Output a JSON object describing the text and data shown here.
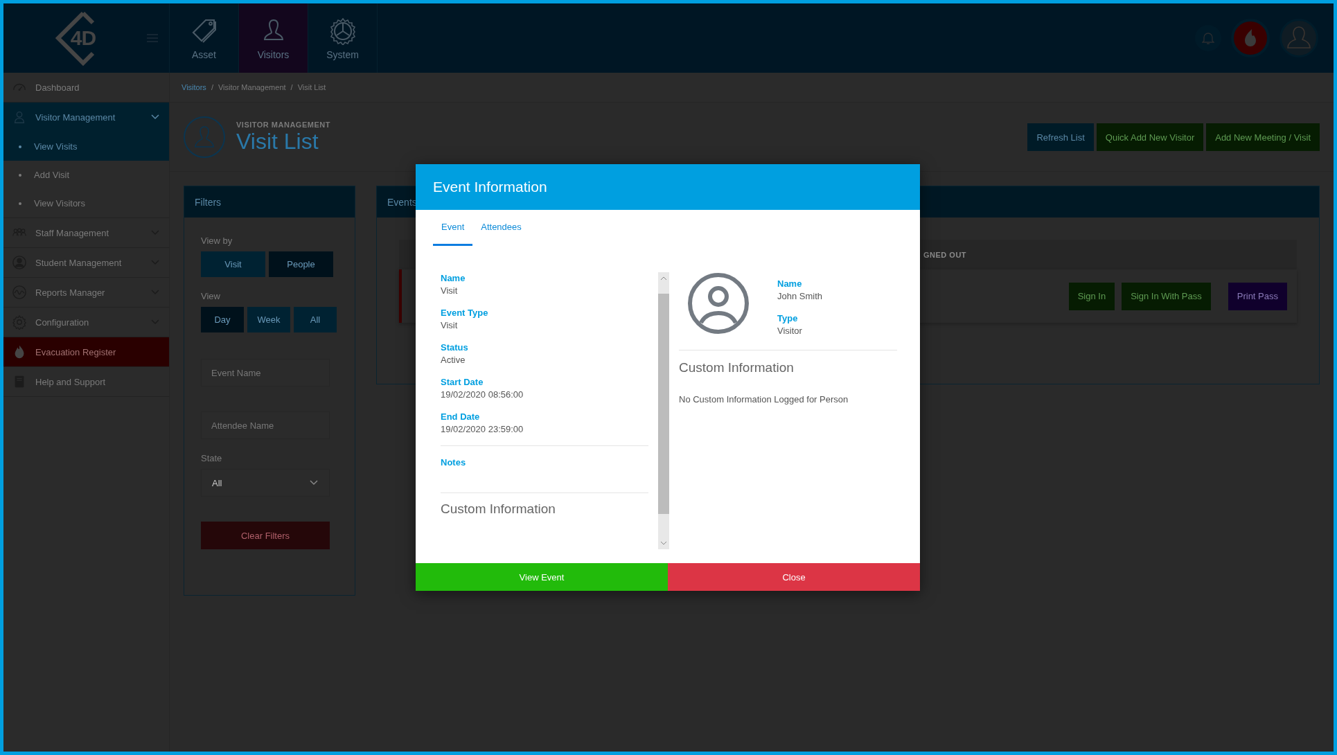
{
  "header": {
    "logo_text": "4D",
    "nav_tabs": [
      {
        "label": "Asset",
        "selected": false
      },
      {
        "label": "Visitors",
        "selected": true
      },
      {
        "label": "System",
        "selected": false
      }
    ]
  },
  "sidebar": {
    "items": [
      {
        "label": "Dashboard",
        "kind": "link",
        "selected": false
      },
      {
        "label": "Visitor Management",
        "kind": "group",
        "selected": true,
        "children": [
          {
            "label": "View Visits",
            "selected": true
          },
          {
            "label": "Add Visit",
            "selected": false
          },
          {
            "label": "View Visitors",
            "selected": false
          }
        ]
      },
      {
        "label": "Staff Management",
        "kind": "group",
        "selected": false
      },
      {
        "label": "Student Management",
        "kind": "group",
        "selected": false
      },
      {
        "label": "Reports Manager",
        "kind": "group",
        "selected": false
      },
      {
        "label": "Configuration",
        "kind": "group",
        "selected": false
      },
      {
        "label": "Evacuation Register",
        "kind": "alert",
        "selected": false
      },
      {
        "label": "Help and Support",
        "kind": "link",
        "selected": false
      }
    ]
  },
  "breadcrumb": {
    "items": [
      "Visitors",
      "Visitor Management",
      "Visit List"
    ],
    "separators": [
      "/",
      "/"
    ]
  },
  "page_header": {
    "overline": "VISITOR MANAGEMENT",
    "title": "Visit List"
  },
  "actions": [
    {
      "label": "Refresh List",
      "kind": "primary"
    },
    {
      "label": "Quick Add New Visitor",
      "kind": "success"
    },
    {
      "label": "Add New Meeting / Visit",
      "kind": "success"
    }
  ],
  "filters": {
    "title": "Filters",
    "view_by_label": "View by",
    "view_by": [
      {
        "label": "Visit",
        "selected": false
      },
      {
        "label": "People",
        "selected": true
      }
    ],
    "view_label": "View",
    "view": [
      {
        "label": "Day",
        "selected": true
      },
      {
        "label": "Week",
        "selected": false
      },
      {
        "label": "All",
        "selected": false
      }
    ],
    "event_name": {
      "placeholder": "Event Name"
    },
    "attendee_name": {
      "placeholder": "Attendee Name"
    },
    "state_label": "State",
    "state": {
      "value": "All"
    },
    "clear_button": {
      "label": "Clear Filters",
      "kind": "danger"
    }
  },
  "events_panel": {
    "title": "Events",
    "column_header": "GNED OUT",
    "row_buttons": [
      {
        "label": "Sign In",
        "kind": "success"
      },
      {
        "label": "Sign In With Pass",
        "kind": "success"
      },
      {
        "label": "Print Pass",
        "kind": "purple"
      }
    ]
  },
  "modal": {
    "title": "Event Information",
    "tabs": [
      {
        "label": "Event",
        "selected": true
      },
      {
        "label": "Attendees",
        "selected": false
      }
    ],
    "event_fields": [
      {
        "label": "Name",
        "value": "Visit"
      },
      {
        "label": "Event Type",
        "value": "Visit"
      },
      {
        "label": "Status",
        "value": "Active"
      },
      {
        "label": "Start Date",
        "value": "19/02/2020 08:56:00"
      },
      {
        "label": "End Date",
        "value": "19/02/2020 23:59:00"
      }
    ],
    "notes_label": "Notes",
    "custom_info_title": "Custom Information",
    "person": {
      "fields": [
        {
          "label": "Name",
          "value": "John Smith"
        },
        {
          "label": "Type",
          "value": "Visitor"
        }
      ],
      "custom_info_title": "Custom Information",
      "custom_info_text": "No Custom Information Logged for Person"
    },
    "buttons": [
      {
        "label": "View Event",
        "kind": "success"
      },
      {
        "label": "Close",
        "kind": "danger"
      }
    ]
  }
}
